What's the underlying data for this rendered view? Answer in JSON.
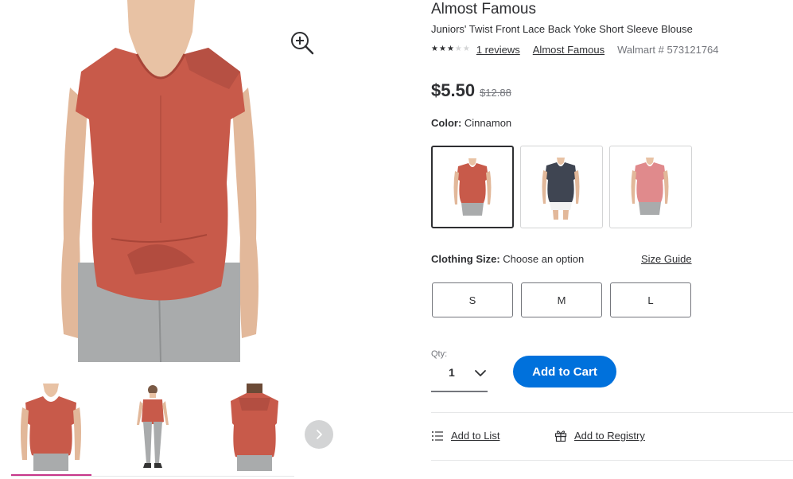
{
  "product": {
    "brand": "Almost Famous",
    "title": "Juniors' Twist Front Lace Back Yoke Short Sleeve Blouse",
    "rating_stars": 3,
    "rating_max": 5,
    "reviews_link": "1 reviews",
    "brand_link": "Almost Famous",
    "walmart_id": "Walmart # 573121764",
    "price": "$5.50",
    "was_price": "$12.88"
  },
  "color": {
    "label": "Color:",
    "selected": "Cinnamon",
    "swatches": [
      "cinnamon",
      "charcoal",
      "rose"
    ],
    "swatch_colors": [
      "#c85a4a",
      "#3f4552",
      "#e08a8c"
    ]
  },
  "size": {
    "label": "Clothing Size:",
    "prompt": "Choose an option",
    "guide_link": "Size Guide",
    "options": [
      "S",
      "M",
      "L"
    ]
  },
  "quantity": {
    "label": "Qty:",
    "value": "1"
  },
  "actions": {
    "add_to_cart": "Add to Cart",
    "add_to_list": "Add to List",
    "add_to_registry": "Add to Registry"
  },
  "gallery": {
    "main_icon": "zoom-in-icon",
    "next_icon": "chevron-right-icon",
    "thumbnail_count": 3,
    "selected_thumbnail": 1
  },
  "colors": {
    "primary": "#0071dc",
    "indicator": "#c7378a",
    "text": "#2e2f32",
    "muted": "#74767c"
  }
}
